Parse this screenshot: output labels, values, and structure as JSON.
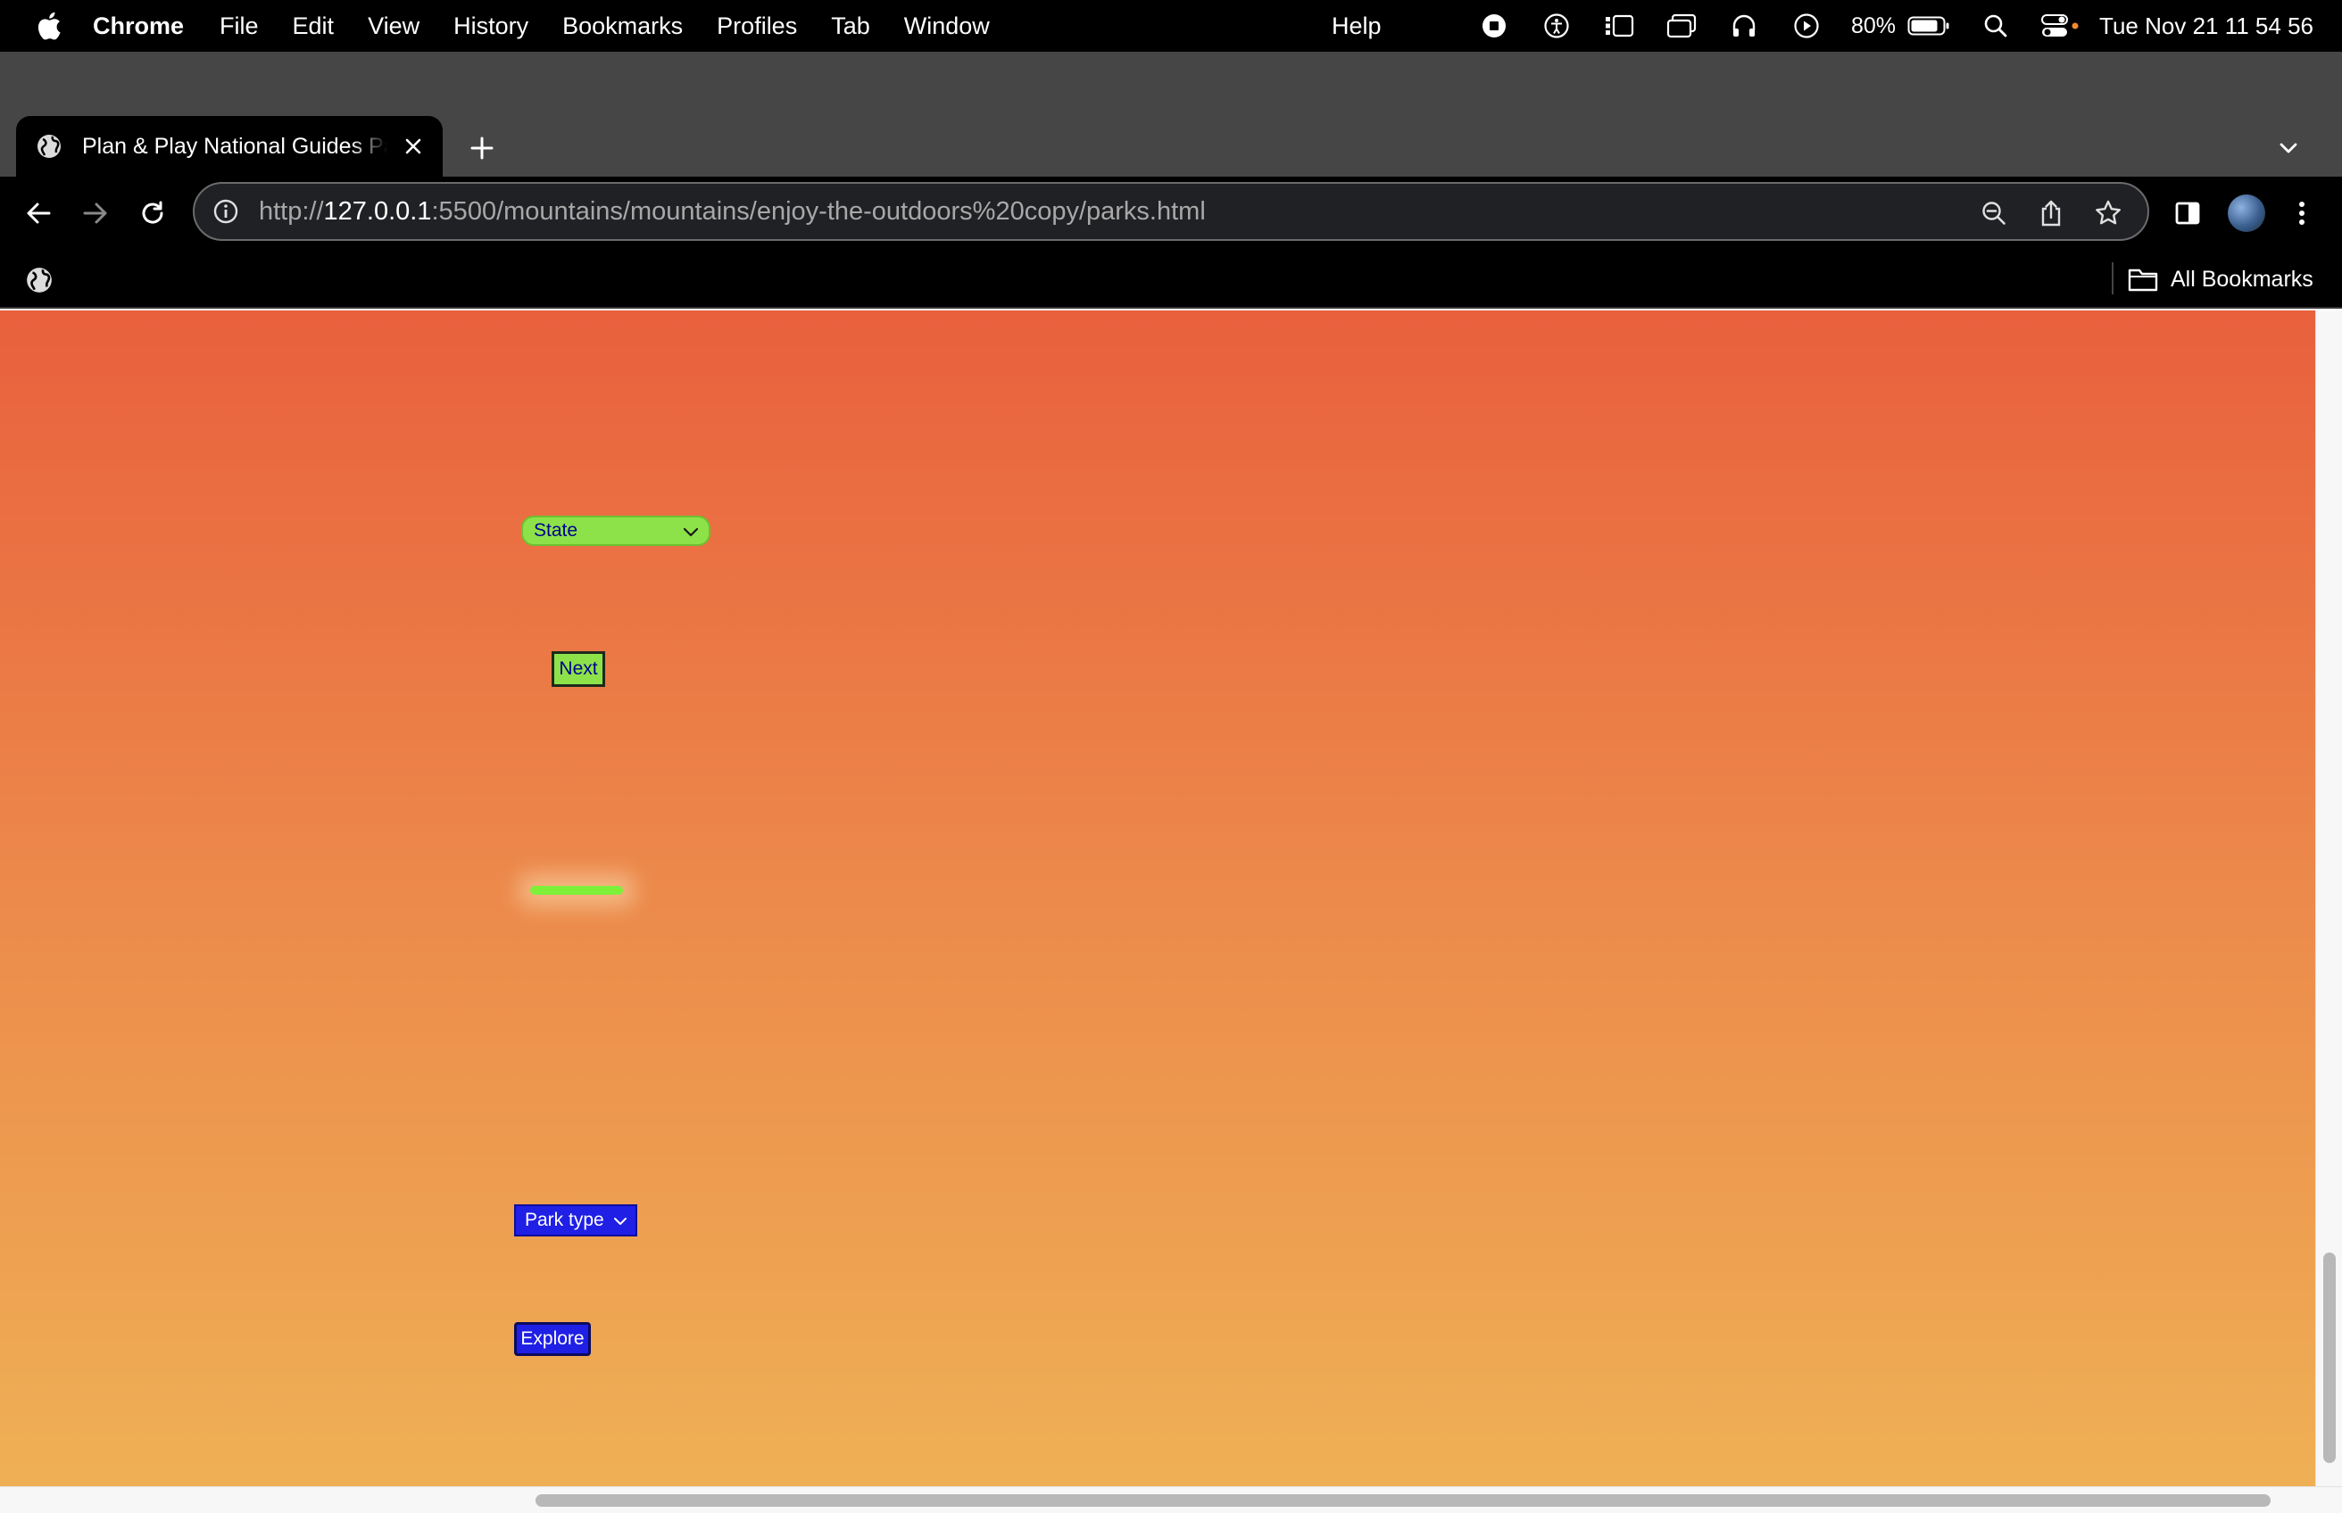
{
  "menubar": {
    "app_name": "Chrome",
    "items": [
      "File",
      "Edit",
      "View",
      "History",
      "Bookmarks",
      "Profiles",
      "Tab",
      "Window"
    ],
    "help": "Help",
    "battery_percent": "80%",
    "clock": "Tue Nov 21  11 54 56"
  },
  "browser": {
    "tab_title": "Plan & Play National Guides Parks",
    "url_scheme": "http://",
    "url_host": "127.0.0.1",
    "url_rest": ":5500/mountains/mountains/enjoy-the-outdoors%20copy/parks.html",
    "bookmarks_label": "All Bookmarks"
  },
  "page": {
    "state_select": {
      "value": "State"
    },
    "next_button": "Next",
    "park_type_select": {
      "value": "Park type"
    },
    "explore_button": "Explore"
  },
  "colors": {
    "gradient_top": "#e9603d",
    "gradient_bottom": "#efb055",
    "lime": "#8de24a",
    "blue_button": "#1f1fe6",
    "dark_blue_text": "#00008b"
  },
  "scroll": {
    "vertical_position": 0.84,
    "horizontal_position": 0.23
  }
}
